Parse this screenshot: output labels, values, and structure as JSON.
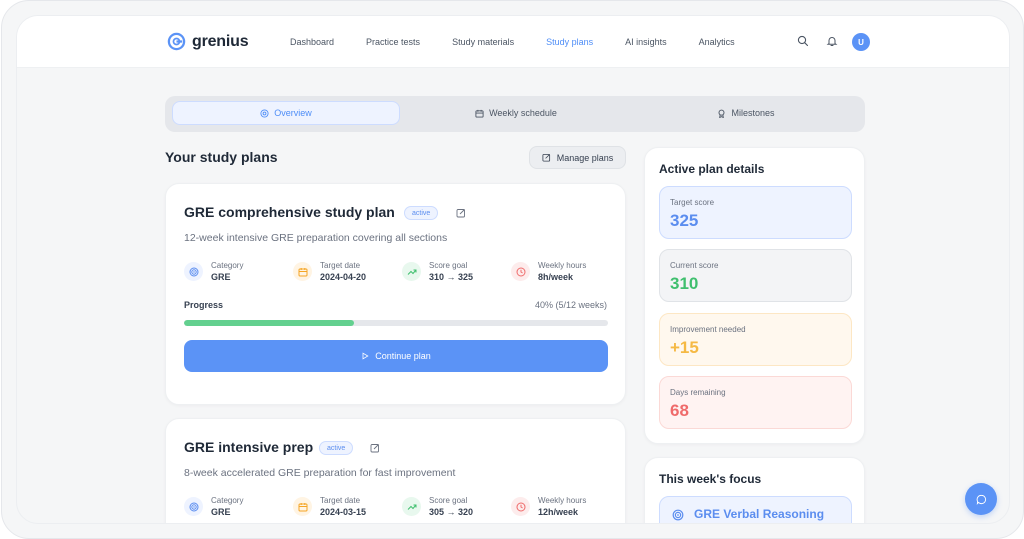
{
  "brand": {
    "name": "grenius"
  },
  "nav": {
    "items": [
      {
        "label": "Dashboard"
      },
      {
        "label": "Practice tests"
      },
      {
        "label": "Study materials"
      },
      {
        "label": "Study plans"
      },
      {
        "label": "AI insights"
      },
      {
        "label": "Analytics"
      }
    ],
    "active": "Study plans"
  },
  "user": {
    "initial": "U"
  },
  "tabs": [
    {
      "label": "Overview",
      "icon": "target-icon"
    },
    {
      "label": "Weekly schedule",
      "icon": "calendar-icon"
    },
    {
      "label": "Milestones",
      "icon": "award-icon"
    }
  ],
  "main": {
    "title": "Your study plans",
    "manage_label": "Manage plans"
  },
  "plans": [
    {
      "title": "GRE comprehensive study plan",
      "status": "active",
      "description": "12-week intensive GRE preparation covering all sections",
      "stats": [
        {
          "label": "Category",
          "value": "GRE"
        },
        {
          "label": "Target date",
          "value": "2024-04-20"
        },
        {
          "label": "Score goal",
          "value": "310 → 325"
        },
        {
          "label": "Weekly hours",
          "value": "8h/week"
        }
      ],
      "progress_label": "Progress",
      "progress_text": "40% (5/12 weeks)",
      "progress_fraction": 0.4,
      "button_label": "Continue plan"
    },
    {
      "title": "GRE intensive prep",
      "status": "active",
      "description": "8-week accelerated GRE preparation for fast improvement",
      "stats": [
        {
          "label": "Category",
          "value": "GRE"
        },
        {
          "label": "Target date",
          "value": "2024-03-15"
        },
        {
          "label": "Score goal",
          "value": "305 → 320"
        },
        {
          "label": "Weekly hours",
          "value": "12h/week"
        }
      ]
    }
  ],
  "details": {
    "title": "Active plan details",
    "metrics": [
      {
        "label": "Target score",
        "value": "325",
        "color": "#5b8def"
      },
      {
        "label": "Current score",
        "value": "310",
        "color": "#3fbf6e"
      },
      {
        "label": "Improvement needed",
        "value": "+15",
        "color": "#f5b944"
      },
      {
        "label": "Days remaining",
        "value": "68",
        "color": "#ef6b6b"
      }
    ]
  },
  "focus": {
    "title": "This week's focus",
    "items": [
      {
        "label": "GRE Verbal Reasoning"
      }
    ]
  },
  "colors": {
    "accent": "#5b93f6",
    "progress": "#63d08f"
  }
}
